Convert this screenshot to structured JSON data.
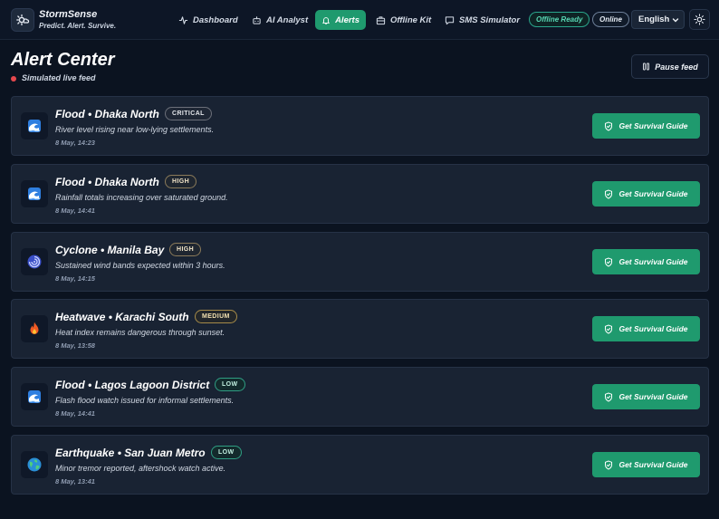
{
  "brand": {
    "name": "StormSense",
    "tagline": "Predict. Alert. Survive."
  },
  "nav": {
    "dashboard": "Dashboard",
    "ai_analyst": "AI Analyst",
    "alerts": "Alerts",
    "offline_kit": "Offline Kit",
    "sms_simulator": "SMS Simulator"
  },
  "status": {
    "offline_ready": "Offline Ready",
    "online": "Online"
  },
  "language": {
    "selected": "English"
  },
  "page": {
    "title": "Alert Center",
    "live_label": "Simulated live feed",
    "pause_label": "Pause feed"
  },
  "alerts": [
    {
      "title": "Flood • Dhaka North",
      "severity": "CRITICAL",
      "description": "River level rising near low-lying settlements.",
      "time": "8 May, 14:23",
      "icon": "flood-wave-icon",
      "action": "Get Survival Guide"
    },
    {
      "title": "Flood • Dhaka North",
      "severity": "HIGH",
      "description": "Rainfall totals increasing over saturated ground.",
      "time": "8 May, 14:41",
      "icon": "flood-wave-icon",
      "action": "Get Survival Guide"
    },
    {
      "title": "Cyclone • Manila Bay",
      "severity": "HIGH",
      "description": "Sustained wind bands expected within 3 hours.",
      "time": "8 May, 14:15",
      "icon": "cyclone-icon",
      "action": "Get Survival Guide"
    },
    {
      "title": "Heatwave • Karachi South",
      "severity": "MEDIUM",
      "description": "Heat index remains dangerous through sunset.",
      "time": "8 May, 13:58",
      "icon": "fire-icon",
      "action": "Get Survival Guide"
    },
    {
      "title": "Flood • Lagos Lagoon District",
      "severity": "LOW",
      "description": "Flash flood watch issued for informal settlements.",
      "time": "8 May, 14:41",
      "icon": "flood-wave-icon",
      "action": "Get Survival Guide"
    },
    {
      "title": "Earthquake • San Juan Metro",
      "severity": "LOW",
      "description": "Minor tremor reported, aftershock watch active.",
      "time": "8 May, 13:41",
      "icon": "globe-icon",
      "action": "Get Survival Guide"
    }
  ],
  "colors": {
    "accent": "#1f9a6e",
    "background": "#0b1320",
    "card": "#192333",
    "live_dot": "#e5484d"
  }
}
